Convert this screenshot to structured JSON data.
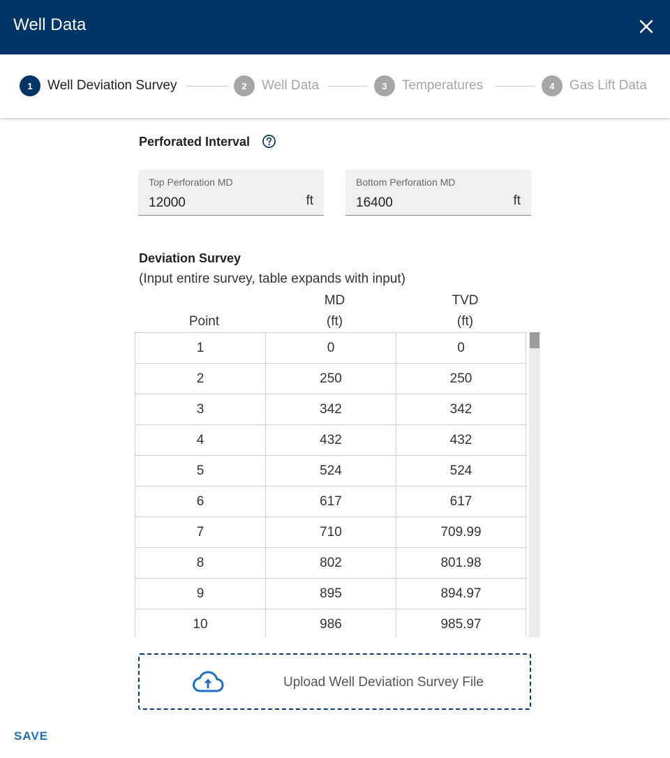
{
  "dialog": {
    "title": "Well Data"
  },
  "stepper": {
    "steps": [
      {
        "number": "1",
        "label": "Well Deviation Survey",
        "state": "active"
      },
      {
        "number": "2",
        "label": "Well Data",
        "state": "inactive"
      },
      {
        "number": "3",
        "label": "Temperatures",
        "state": "inactive"
      },
      {
        "number": "4",
        "label": "Gas Lift Data",
        "state": "inactive"
      }
    ]
  },
  "perforated_interval": {
    "title": "Perforated Interval",
    "top": {
      "label": "Top Perforation MD",
      "value": "12000",
      "unit": "ft"
    },
    "bottom": {
      "label": "Bottom Perforation MD",
      "value": "16400",
      "unit": "ft"
    }
  },
  "deviation_survey": {
    "title": "Deviation Survey",
    "subtitle": "(Input entire survey, table expands with input)",
    "columns": {
      "point": "Point",
      "md_name": "MD",
      "md_unit": "(ft)",
      "tvd_name": "TVD",
      "tvd_unit": "(ft)"
    },
    "rows": [
      [
        "1",
        "0",
        "0"
      ],
      [
        "2",
        "250",
        "250"
      ],
      [
        "3",
        "342",
        "342"
      ],
      [
        "4",
        "432",
        "432"
      ],
      [
        "5",
        "524",
        "524"
      ],
      [
        "6",
        "617",
        "617"
      ],
      [
        "7",
        "710",
        "709.99"
      ],
      [
        "8",
        "802",
        "801.98"
      ],
      [
        "9",
        "895",
        "894.97"
      ],
      [
        "10",
        "986",
        "985.97"
      ]
    ]
  },
  "upload": {
    "label": "Upload Well Deviation Survey File",
    "icon": "cloud-upload-icon"
  },
  "footer": {
    "save_label": "SAVE"
  },
  "colors": {
    "header": "#003366",
    "accent_link": "#1b6ec2",
    "inactive_step": "#a6a6a6"
  }
}
